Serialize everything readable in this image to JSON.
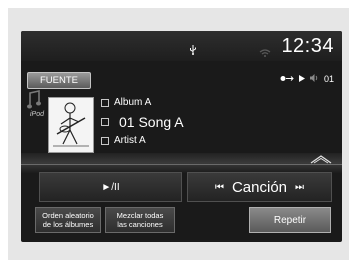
{
  "status_bar": {
    "time": "12:34",
    "icons": [
      "usb-icon",
      "wifi-icon"
    ]
  },
  "source_button": {
    "label": "FUENTE"
  },
  "playback_status": {
    "track_number": "01",
    "icons": [
      "repeat-indicator-icon",
      "play-indicator-icon",
      "volume-icon"
    ]
  },
  "device": {
    "label": "iPod"
  },
  "now_playing": {
    "album": "Album A",
    "track": "01 Song A",
    "artist": "Artist A"
  },
  "controls": {
    "play_pause_label": "►/II",
    "prev_symbol": "⏮",
    "track_label": "Canción",
    "next_symbol": "⏭"
  },
  "bottom_buttons": {
    "shuffle_album_line1": "Orden aleatorio",
    "shuffle_album_line2": "de los álbumes",
    "shuffle_all_line1": "Mezclar todas",
    "shuffle_all_line2": "las canciones",
    "repeat_label": "Repetir"
  },
  "colors": {
    "screen_bg": "#1a1a1a",
    "text": "#ffffff",
    "frame_bg": "#e6e6e6"
  }
}
